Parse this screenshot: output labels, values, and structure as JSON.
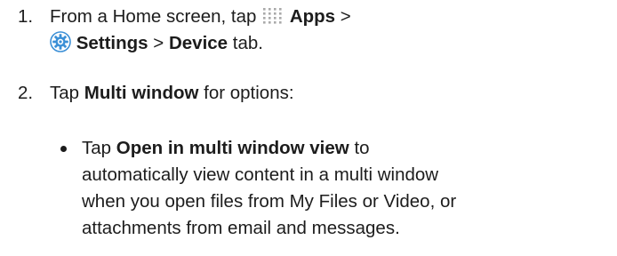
{
  "steps": [
    {
      "number": "1.",
      "line1": {
        "pre": "From a Home screen, tap",
        "apps_label": "Apps",
        "sep": ">"
      },
      "line2": {
        "settings_label": "Settings",
        "sep": ">",
        "device_label": "Device",
        "post": "tab."
      },
      "icons": [
        "apps-grid-icon",
        "settings-gear-icon"
      ]
    },
    {
      "number": "2.",
      "pre": "Tap",
      "bold": "Multi window",
      "post": "for options:"
    }
  ],
  "bullet": {
    "pre": "Tap",
    "bold": "Open in multi window view",
    "post": "to",
    "lines": [
      "automatically view content in a multi window",
      "when you open files from My Files or Video, or",
      "attachments from email and messages."
    ]
  },
  "colors": {
    "text": "#1c1c1c",
    "apps_icon": "#a9a9a9",
    "settings_icon": "#3a8fd6"
  }
}
